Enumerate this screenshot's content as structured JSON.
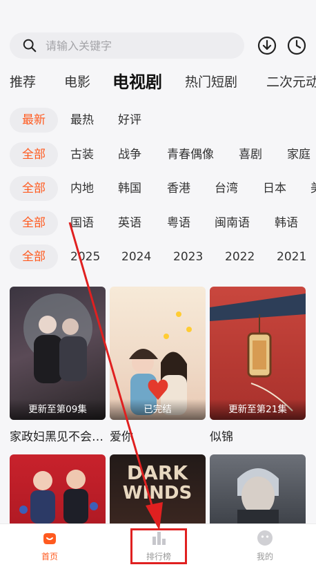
{
  "search": {
    "placeholder": "请输入关键字"
  },
  "header": {
    "icons": [
      "download-icon",
      "history-clock-icon"
    ]
  },
  "tabs": [
    {
      "label": "推荐"
    },
    {
      "label": "电影"
    },
    {
      "label": "电视剧",
      "active": true
    },
    {
      "label": "热门短剧"
    },
    {
      "label": "二次元动"
    }
  ],
  "filters": {
    "sort": [
      "最新",
      "最热",
      "好评"
    ],
    "genre": [
      "全部",
      "古装",
      "战争",
      "青春偶像",
      "喜剧",
      "家庭"
    ],
    "region": [
      "全部",
      "内地",
      "韩国",
      "香港",
      "台湾",
      "日本",
      "美"
    ],
    "language": [
      "全部",
      "国语",
      "英语",
      "粤语",
      "闽南语",
      "韩语"
    ],
    "year": [
      "全部",
      "2025",
      "2024",
      "2023",
      "2022",
      "2021"
    ]
  },
  "cards": [
    {
      "title": "家政妇黑见不会…",
      "badge": "更新至第09集"
    },
    {
      "title": "爱你",
      "badge": "已完结"
    },
    {
      "title": "似锦",
      "badge": "更新至第21集"
    }
  ],
  "cards_row2": [
    {
      "title": ""
    },
    {
      "title": "DARK WINDS"
    },
    {
      "title": ""
    }
  ],
  "bottom_nav": [
    {
      "label": "首页",
      "active": true
    },
    {
      "label": "排行榜"
    },
    {
      "label": "我的"
    }
  ],
  "colors": {
    "accent": "#ff5a1f",
    "annotation": "#e02020"
  }
}
